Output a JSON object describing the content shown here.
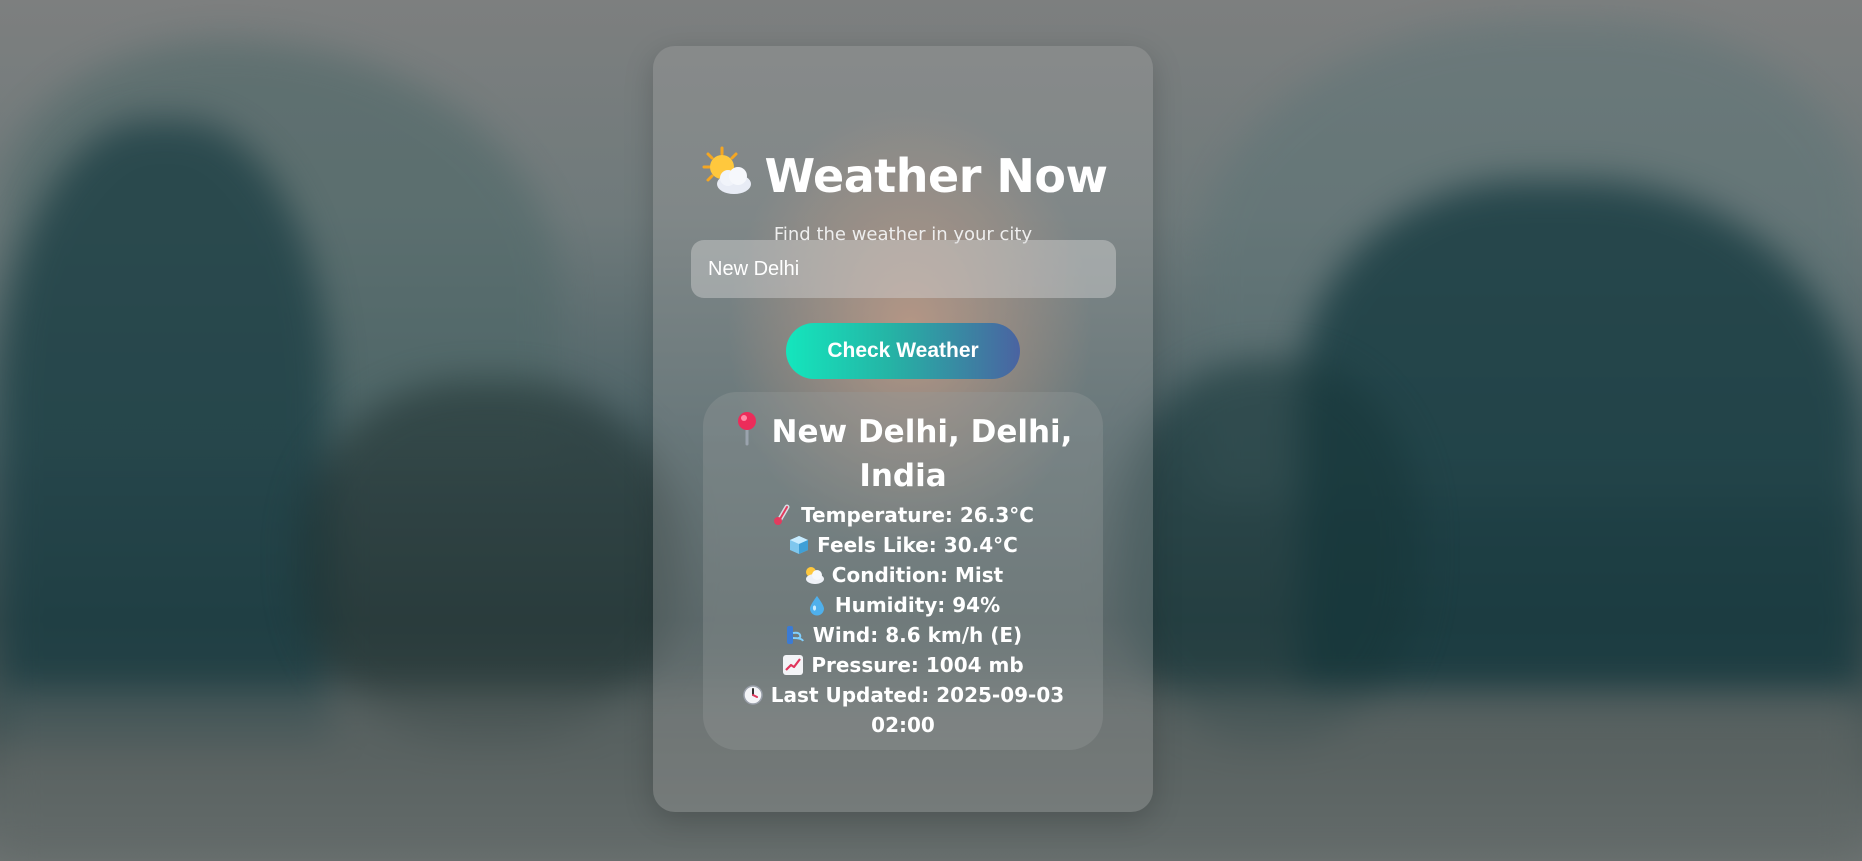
{
  "app": {
    "title": "Weather Now",
    "subtitle": "Find the weather in your city",
    "title_icon": "sun-behind-cloud-icon"
  },
  "search": {
    "value": "New Delhi",
    "placeholder": ""
  },
  "check_button": {
    "label": "Check Weather"
  },
  "result": {
    "location": "New Delhi, Delhi, India",
    "location_icon": "pin-icon",
    "rows": [
      {
        "icon": "thermometer-icon",
        "label": "Temperature:",
        "value": "26.3°C"
      },
      {
        "icon": "ice-cube-icon",
        "label": "Feels Like:",
        "value": "30.4°C"
      },
      {
        "icon": "cloud-icon",
        "label": "Condition:",
        "value": "Mist"
      },
      {
        "icon": "droplet-icon",
        "label": "Humidity:",
        "value": "94%"
      },
      {
        "icon": "wind-icon",
        "label": "Wind:",
        "value": "8.6 km/h (E)"
      },
      {
        "icon": "chart-increasing-icon",
        "label": "Pressure:",
        "value": "1004 mb"
      },
      {
        "icon": "clock-icon",
        "label": "Last Updated:",
        "value": "2025-09-03 02:00"
      }
    ]
  },
  "colors": {
    "button_gradient_start": "#14e6bd",
    "button_gradient_end": "#4a63a1",
    "text": "#ffffff"
  }
}
